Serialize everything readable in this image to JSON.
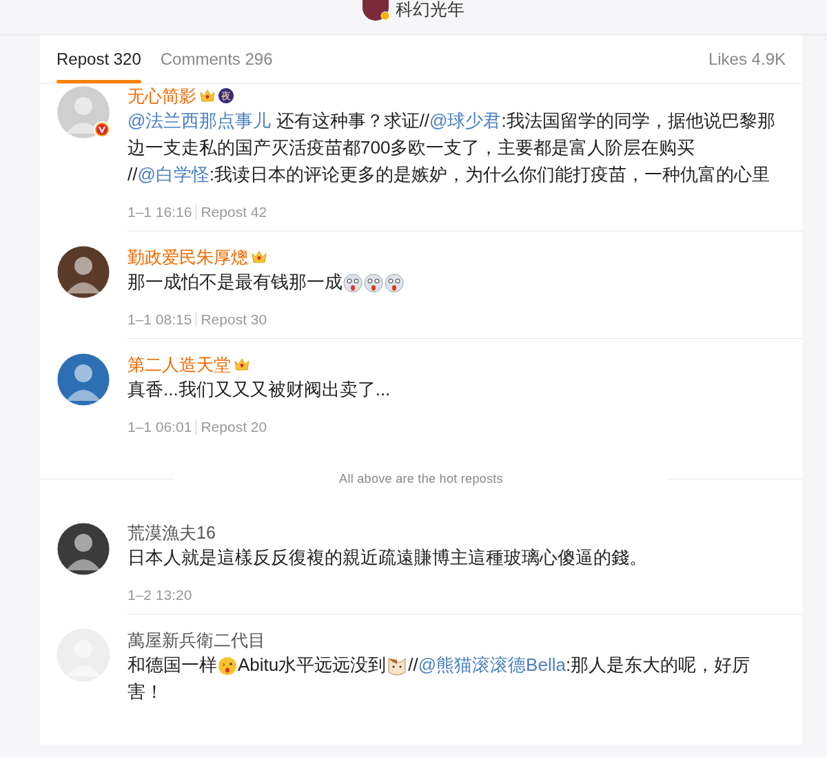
{
  "header": {
    "account_name": "科幻光年",
    "account_verified": true
  },
  "tabs": [
    {
      "label": "Repost 320",
      "selected": true
    },
    {
      "label": "Comments 296",
      "selected": false
    }
  ],
  "likes": "Likes 4.9K",
  "hot_reposts": [
    {
      "name": "无心简影",
      "vip": true,
      "verified": true,
      "badges": [
        {
          "kind": "crown"
        },
        {
          "kind": "label",
          "text": "夜"
        }
      ],
      "body": [
        {
          "kind": "mention",
          "text": "@法兰西那点事儿"
        },
        {
          "kind": "text",
          "text": " 还有这种事？求证//"
        },
        {
          "kind": "mention",
          "text": "@球少君"
        },
        {
          "kind": "text",
          "text": ":我法国留学的同学，据他说巴黎那边一支走私的国产灭活疫苗都700多欧一支了，主要都是富人阶层在购买 //"
        },
        {
          "kind": "mention",
          "text": "@白学怪"
        },
        {
          "kind": "text",
          "text": ":我读日本的评论更多的是嫉妒，为什么你们能打疫苗，一种仇富的心里"
        }
      ],
      "time": "1–1 16:16",
      "reposts": "Repost 42"
    },
    {
      "name": "勤政爱民朱厚熜",
      "vip": true,
      "verified": false,
      "badges": [
        {
          "kind": "crown"
        }
      ],
      "body": [
        {
          "kind": "text",
          "text": "那一成怕不是最有钱那一成"
        },
        {
          "kind": "dog"
        },
        {
          "kind": "dog"
        },
        {
          "kind": "dog"
        }
      ],
      "time": "1–1 08:15",
      "reposts": "Repost 30"
    },
    {
      "name": "第二人造天堂",
      "vip": true,
      "verified": false,
      "badges": [
        {
          "kind": "crown"
        }
      ],
      "body": [
        {
          "kind": "text",
          "text": "真香...我们又又又被财阀出卖了..."
        }
      ],
      "time": "1–1 06:01",
      "reposts": "Repost 20"
    }
  ],
  "hot_divider": "All above are the hot reposts",
  "reposts": [
    {
      "name": "荒漠漁夫16",
      "vip": false,
      "verified": false,
      "body": [
        {
          "kind": "text",
          "text": "日本人就是這樣反反復複的親近疏遠賺博主這種玻璃心傻逼的錢。"
        }
      ],
      "time": "1–2 13:20"
    },
    {
      "name": "萬屋新兵衛二代目",
      "vip": false,
      "verified": false,
      "body": [
        {
          "kind": "text",
          "text": "和德国一样"
        },
        {
          "kind": "wink"
        },
        {
          "kind": "text",
          "text": "Abitu水平远远没到"
        },
        {
          "kind": "cat"
        },
        {
          "kind": "text",
          "text": "//"
        },
        {
          "kind": "mention",
          "text": "@熊猫滚滚德Bella"
        },
        {
          "kind": "text",
          "text": ":那人是东大的呢，好厉害！"
        }
      ]
    }
  ]
}
